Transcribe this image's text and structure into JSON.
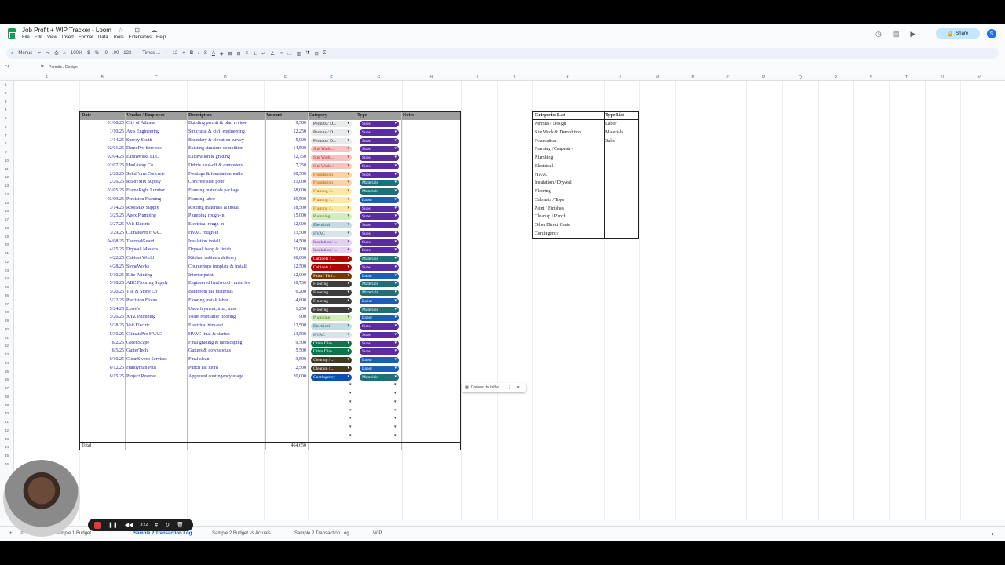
{
  "doc": {
    "title": "Job Profit + WIP Tracker - Loom",
    "menus": [
      "File",
      "Edit",
      "View",
      "Insert",
      "Format",
      "Data",
      "Tools",
      "Extensions",
      "Help"
    ],
    "share": "Share",
    "avatar": "S"
  },
  "toolbar": {
    "menus": "Menus",
    "zoom": "100%",
    "currency": "$",
    "percent": "%",
    "dec1": ".0",
    "dec2": ".00",
    "fmt123": "123",
    "font": "Times ...",
    "size": "12"
  },
  "formula": {
    "cell": "F4",
    "value": "Permits / Design"
  },
  "columns": [
    "A",
    "B",
    "C",
    "D",
    "E",
    "F",
    "G",
    "H",
    "I",
    "J",
    "K",
    "L",
    "M",
    "N",
    "O",
    "P",
    "Q",
    "R",
    "S",
    "T",
    "U",
    "V"
  ],
  "rows": [
    "1",
    "2",
    "3",
    "4",
    "5",
    "6",
    "7",
    "8",
    "9",
    "10",
    "11",
    "12",
    "13",
    "14",
    "15",
    "16",
    "17",
    "18",
    "19",
    "20",
    "21",
    "22",
    "23",
    "24",
    "25",
    "26",
    "27",
    "28",
    "29",
    "30",
    "31",
    "32",
    "33",
    "34",
    "35",
    "36",
    "37",
    "38",
    "39",
    "40",
    "41",
    "42",
    "43",
    "44",
    "45",
    "46"
  ],
  "table": {
    "headers": {
      "date": "Date",
      "vendor": "Vendor / Employee",
      "desc": "Description",
      "amount": "Amount",
      "category": "Category",
      "type": "Type",
      "notes": "Notes"
    },
    "rows": [
      {
        "date": "01/08/25",
        "vendor": "City of Atlanta",
        "desc": "Building permit & plan review",
        "amt": "9,500",
        "cat": "Permits / D...",
        "catc": "#e8eaed",
        "catt": "#202124",
        "type": "Subs",
        "typec": "#5b2ba1"
      },
      {
        "date": "1/10/25",
        "vendor": "Axis Engineering",
        "desc": "Structural & civil engineering",
        "amt": "12,250",
        "cat": "Permits / D...",
        "catc": "#e8eaed",
        "catt": "#202124",
        "type": "Subs",
        "typec": "#5b2ba1"
      },
      {
        "date": "1/14/25",
        "vendor": "Survey South",
        "desc": "Boundary & elevation survey",
        "amt": "5,000",
        "cat": "Permits / D...",
        "catc": "#e8eaed",
        "catt": "#202124",
        "type": "Subs",
        "typec": "#5b2ba1"
      },
      {
        "date": "02/01/25",
        "vendor": "DemoPro Services",
        "desc": "Existing structure demolition",
        "amt": "14,500",
        "cat": "Site Work ...",
        "catc": "#f6c4c0",
        "catt": "#b3261e",
        "type": "Subs",
        "typec": "#5b2ba1"
      },
      {
        "date": "02/04/25",
        "vendor": "EarthWorks LLC",
        "desc": "Excavation & grading",
        "amt": "12,750",
        "cat": "Site Work ...",
        "catc": "#f6c4c0",
        "catt": "#b3261e",
        "type": "Subs",
        "typec": "#5b2ba1"
      },
      {
        "date": "02/07/25",
        "vendor": "HaulAway Co",
        "desc": "Debris haul-off & dumpsters",
        "amt": "7,250",
        "cat": "Site Work ...",
        "catc": "#f6c4c0",
        "catt": "#b3261e",
        "type": "Subs",
        "typec": "#5b2ba1"
      },
      {
        "date": "2/20/25",
        "vendor": "SolidForm Concrete",
        "desc": "Footings & foundation walls",
        "amt": "38,500",
        "cat": "Foundation",
        "catc": "#fbd1a6",
        "catt": "#b35a00",
        "type": "Subs",
        "typec": "#5b2ba1"
      },
      {
        "date": "2/26/25",
        "vendor": "ReadyMix Supply",
        "desc": "Concrete slab pour",
        "amt": "21,000",
        "cat": "Foundation",
        "catc": "#fbd1a6",
        "catt": "#b35a00",
        "type": "Materials",
        "typec": "#1e6f76"
      },
      {
        "date": "03/05/25",
        "vendor": "FrameRight Lumber",
        "desc": "Framing materials package",
        "amt": "58,000",
        "cat": "Framing / ...",
        "catc": "#fde8a5",
        "catt": "#a05d00",
        "type": "Materials",
        "typec": "#1e6f76"
      },
      {
        "date": "03/09/25",
        "vendor": "Precision Framing",
        "desc": "Framing labor",
        "amt": "29,500",
        "cat": "Framing / ...",
        "catc": "#fde8a5",
        "catt": "#a05d00",
        "type": "Labor",
        "typec": "#1a5fb4"
      },
      {
        "date": "3/14/25",
        "vendor": "RoofMax Supply",
        "desc": "Roofing materials & install",
        "amt": "18,500",
        "cat": "Framing / ...",
        "catc": "#fde8a5",
        "catt": "#a05d00",
        "type": "Subs",
        "typec": "#5b2ba1"
      },
      {
        "date": "3/25/25",
        "vendor": "Apex Plumbing",
        "desc": "Plumbing rough-in",
        "amt": "15,000",
        "cat": "Plumbing",
        "catc": "#d4edbc",
        "catt": "#3b7a1f",
        "type": "Subs",
        "typec": "#5b2ba1"
      },
      {
        "date": "3/27/25",
        "vendor": "Volt Electric",
        "desc": "Electrical rough-in",
        "amt": "12,000",
        "cat": "Electrical",
        "catc": "#c6dbe1",
        "catt": "#215a6c",
        "type": "Subs",
        "typec": "#5b2ba1"
      },
      {
        "date": "3/29/25",
        "vendor": "ClimatePro HVAC",
        "desc": "HVAC rough-in",
        "amt": "13,500",
        "cat": "HVAC",
        "catc": "#d7e4e8",
        "catt": "#215a6c",
        "type": "Subs",
        "typec": "#5b2ba1"
      },
      {
        "date": "04/08/25",
        "vendor": "ThermalGuard",
        "desc": "Insulation install",
        "amt": "14,500",
        "cat": "Insulation / ...",
        "catc": "#e6cff2",
        "catt": "#5a3286",
        "type": "Subs",
        "typec": "#5b2ba1"
      },
      {
        "date": "4/15/25",
        "vendor": "Drywall Masters",
        "desc": "Drywall hang & finish",
        "amt": "21,000",
        "cat": "Insulation / ...",
        "catc": "#e6cff2",
        "catt": "#5a3286",
        "type": "Subs",
        "typec": "#5b2ba1"
      },
      {
        "date": "4/22/25",
        "vendor": "Cabinet World",
        "desc": "Kitchen cabinets delivery",
        "amt": "38,000",
        "cat": "Cabinets / ...",
        "catc": "#b10202",
        "catt": "#ffffff",
        "type": "Materials",
        "typec": "#1e6f76"
      },
      {
        "date": "4/28/25",
        "vendor": "StoneWorks",
        "desc": "Countertops template & install",
        "amt": "12,500",
        "cat": "Cabinets / ...",
        "catc": "#b10202",
        "catt": "#ffffff",
        "type": "Subs",
        "typec": "#5b2ba1"
      },
      {
        "date": "5/10/25",
        "vendor": "Elite Painting",
        "desc": "Interior paint",
        "amt": "12,000",
        "cat": "Paint / Fini...",
        "catc": "#753800",
        "catt": "#ffffff",
        "type": "Labor",
        "typec": "#1a5fb4"
      },
      {
        "date": "5/18/25",
        "vendor": "ABC Flooring Supply",
        "desc": "Engineered hardwood - main lev",
        "amt": "18,750",
        "cat": "Flooring",
        "catc": "#3d3d3d",
        "catt": "#ffffff",
        "type": "Materials",
        "typec": "#1e6f76"
      },
      {
        "date": "5/20/25",
        "vendor": "Tile & Stone Co",
        "desc": "Bathroom tile materials",
        "amt": "6,200",
        "cat": "Flooring",
        "catc": "#3d3d3d",
        "catt": "#ffffff",
        "type": "Materials",
        "typec": "#1e6f76"
      },
      {
        "date": "5/22/25",
        "vendor": "Precision Floors",
        "desc": "Flooring install labor",
        "amt": "4,800",
        "cat": "Flooring",
        "catc": "#3d3d3d",
        "catt": "#ffffff",
        "type": "Labor",
        "typec": "#1a5fb4"
      },
      {
        "date": "5/24/25",
        "vendor": "Lowe's",
        "desc": "Underlayment, trim, misc",
        "amt": "1,250",
        "cat": "Flooring",
        "catc": "#3d3d3d",
        "catt": "#ffffff",
        "type": "Materials",
        "typec": "#1e6f76"
      },
      {
        "date": "5/26/25",
        "vendor": "XYZ Plumbing",
        "desc": "Toilet reset after flooring",
        "amt": "900",
        "cat": "Plumbing",
        "catc": "#d4edbc",
        "catt": "#3b7a1f",
        "type": "Labor",
        "typec": "#1a5fb4"
      },
      {
        "date": "5/28/25",
        "vendor": "Volt Electric",
        "desc": "Electrical trim-out",
        "amt": "12,500",
        "cat": "Electrical",
        "catc": "#c6dbe1",
        "catt": "#215a6c",
        "type": "Subs",
        "typec": "#5b2ba1"
      },
      {
        "date": "5/30/25",
        "vendor": "ClimatePro HVAC",
        "desc": "HVAC final & startup",
        "amt": "13,500",
        "cat": "HVAC",
        "catc": "#d7e4e8",
        "catt": "#215a6c",
        "type": "Subs",
        "typec": "#5b2ba1"
      },
      {
        "date": "6/2/25",
        "vendor": "GreenScape",
        "desc": "Final grading & landscaping",
        "amt": "9,500",
        "cat": "Other Dire...",
        "catc": "#11734b",
        "catt": "#ffffff",
        "type": "Subs",
        "typec": "#5b2ba1"
      },
      {
        "date": "6/5/25",
        "vendor": "GutterTech",
        "desc": "Gutters & downspouts",
        "amt": "5,500",
        "cat": "Other Dire...",
        "catc": "#11734b",
        "catt": "#ffffff",
        "type": "Subs",
        "typec": "#5b2ba1"
      },
      {
        "date": "6/10/25",
        "vendor": "CleanSweep Services",
        "desc": "Final clean",
        "amt": "3,500",
        "cat": "Cleanup / ...",
        "catc": "#473822",
        "catt": "#ffffff",
        "type": "Labor",
        "typec": "#1a5fb4"
      },
      {
        "date": "6/12/25",
        "vendor": "Handyman Plus",
        "desc": "Punch list items",
        "amt": "2,500",
        "cat": "Cleanup / ...",
        "catc": "#473822",
        "catt": "#ffffff",
        "type": "Labor",
        "typec": "#1a5fb4"
      },
      {
        "date": "6/15/25",
        "vendor": "Project Reserve",
        "desc": "Approved contingency usage",
        "amt": "20,000",
        "cat": "Contingency",
        "catc": "#0a53a8",
        "catt": "#ffffff",
        "type": "Materials",
        "typec": "#1e6f76"
      }
    ],
    "total_label": "Total",
    "total_value": "464,650"
  },
  "lists": {
    "cat_header": "Categories List",
    "type_header": "Type List",
    "categories": [
      "Permits / Design",
      "Site Work & Demolition",
      "Foundation",
      "Framing / Carpentry",
      "Plumbing",
      "Electrical",
      "HVAC",
      "Insulation / Drywall",
      "Flooring",
      "Cabinets / Tops",
      "Paint / Finishes",
      "Cleanup / Punch",
      "Other Direct Costs",
      "Contingency"
    ],
    "types": [
      "Labor",
      "Materials",
      "Subs"
    ]
  },
  "convert_label": "Convert to table",
  "tabs": [
    "Sample 1 Budget ...",
    "Sample 2 Transaction Log",
    "Sample 2 Budget vs Actuals",
    "Sample 2 Transaction Log",
    "WIP"
  ],
  "loom": {
    "time": "3:22"
  }
}
